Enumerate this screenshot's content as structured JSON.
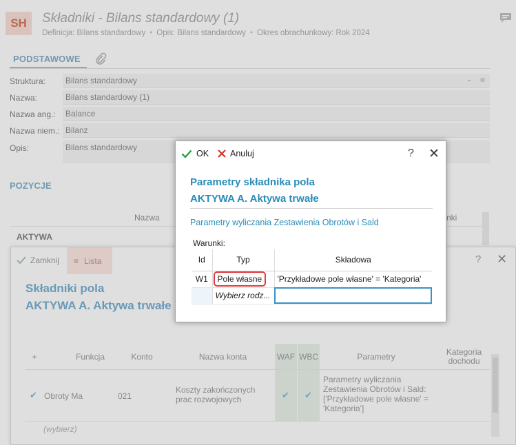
{
  "base": {
    "avatar": "SH",
    "title": "Składniki - Bilans standardowy (1)",
    "subtitle": {
      "definicja": "Definicja: Bilans standardowy",
      "opis": "Opis: Bilans standardowy",
      "okres": "Okres obrachunkowy: Rok 2024"
    },
    "tab": "PODSTAWOWE",
    "form": [
      {
        "label": "Struktura:",
        "value": "Bilans standardowy"
      },
      {
        "label": "Nazwa:",
        "value": "Bilans standardowy (1)"
      },
      {
        "label": "Nazwa ang.:",
        "value": "Balance"
      },
      {
        "label": "Nazwa niem.:",
        "value": "Bilanz"
      },
      {
        "label": "Opis:",
        "value": "Bilans standardowy"
      }
    ],
    "section": "POZYCJE",
    "positions": {
      "col_nazwa": "Nazwa",
      "col_right": "nki",
      "row1": "AKTYWA"
    }
  },
  "middle": {
    "close_label": "Zamknij",
    "list_label": "Lista",
    "help": "?",
    "close_x": "✕",
    "heading1": "Składniki pola",
    "heading2": "AKTYWA A. Aktywa trwałe",
    "columns": [
      "+",
      "Funkcja",
      "Konto",
      "Nazwa konta",
      "WAF",
      "WBC",
      "Parametry",
      "Kategoria dochodu"
    ],
    "row": {
      "funkcja": "Obroty Ma",
      "konto": "021",
      "nazwa_konta": "Koszty zakończonych prac rozwojowych",
      "parametry": "Parametry wyliczania Zestawienia Obrotów i Sald: ['Przykładowe pole własne' = 'Kategoria']"
    },
    "new_row_placeholder": "(wybierz)"
  },
  "modal": {
    "ok_label": "OK",
    "cancel_label": "Anuluj",
    "help": "?",
    "close_x": "✕",
    "heading1": "Parametry składnika pola",
    "heading2": "AKTYWA A. Aktywa trwałe",
    "subheading": "Parametry wyliczania Zestawienia Obrotów i Sald",
    "conditions_label": "Warunki:",
    "table": {
      "headers": [
        "Id",
        "Typ",
        "Składowa"
      ],
      "rows": [
        {
          "id": "W1",
          "typ": "Pole własne",
          "skladowa": "'Przykładowe pole własne' = 'Kategoria'"
        }
      ],
      "new_row_placeholder": "Wybierz rodz..."
    },
    "colors": {
      "accent": "#2a8db8",
      "highlight": "#e23b3b",
      "ok": "#2e9b43",
      "cancel": "#d9332b"
    }
  }
}
